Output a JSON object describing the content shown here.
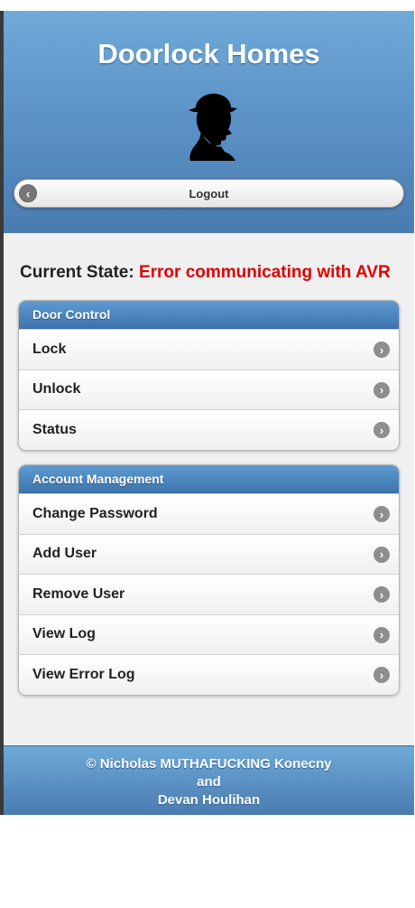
{
  "header": {
    "title": "Doorlock Homes",
    "logo_icon": "sherlock-silhouette-icon",
    "logout_label": "Logout",
    "logout_icon": "arrow-left-icon"
  },
  "status": {
    "label": "Current State:",
    "value": "Error communicating with AVR",
    "value_color": "#e00000"
  },
  "door_control": {
    "title": "Door Control",
    "items": [
      {
        "label": "Lock"
      },
      {
        "label": "Unlock"
      },
      {
        "label": "Status"
      }
    ]
  },
  "account_management": {
    "title": "Account Management",
    "items": [
      {
        "label": "Change Password"
      },
      {
        "label": "Add User"
      },
      {
        "label": "Remove User"
      },
      {
        "label": "View Log"
      },
      {
        "label": "View Error Log"
      }
    ]
  },
  "footer": {
    "line1": "© Nicholas MUTHAFUCKING Konecny",
    "line2": "and",
    "line3": "Devan Houlihan"
  },
  "colors": {
    "header_blue": "#5b92c6",
    "group_header_blue": "#4a82bb",
    "error_red": "#e00000"
  }
}
